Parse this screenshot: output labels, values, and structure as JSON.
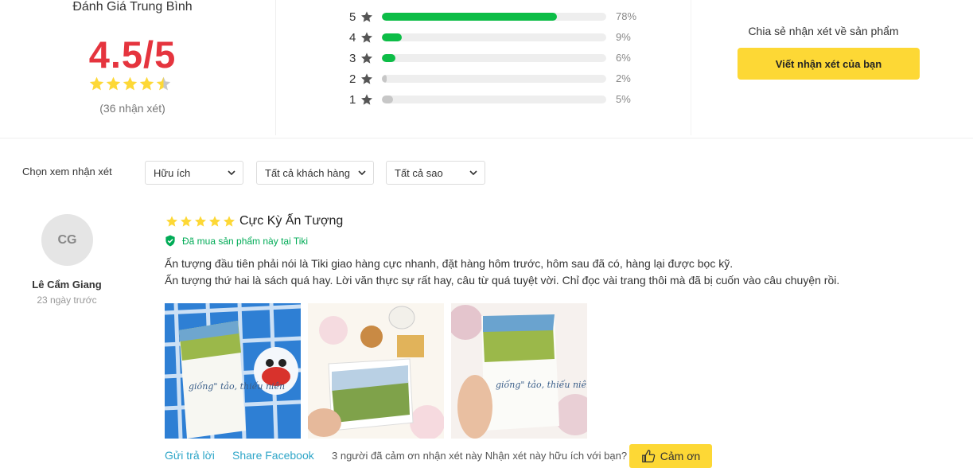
{
  "summary": {
    "title": "Đánh Giá Trung Bình",
    "score": "4.5/5",
    "star_rating": 4.5,
    "count": "(36 nhận xét)"
  },
  "distribution": [
    {
      "stars": "5",
      "percent": "78%",
      "fraction": 0.78
    },
    {
      "stars": "4",
      "percent": "9%",
      "fraction": 0.09
    },
    {
      "stars": "3",
      "percent": "6%",
      "fraction": 0.06
    },
    {
      "stars": "2",
      "percent": "2%",
      "fraction": 0.02
    },
    {
      "stars": "1",
      "percent": "5%",
      "fraction": 0.05
    }
  ],
  "share": {
    "text": "Chia sẻ nhận xét về sản phẩm",
    "button": "Viết nhận xét của bạn"
  },
  "filters": {
    "label": "Chọn xem nhận xét",
    "sort": "Hữu ích",
    "customers": "Tất cả khách hàng",
    "stars": "Tất cả sao"
  },
  "review": {
    "avatar_initials": "CG",
    "name": "Lê Cẩm Giang",
    "time": "23 ngày trước",
    "stars": 5,
    "title": "Cực Kỳ Ấn Tượng",
    "verified": "Đã mua sản phẩm này tại Tiki",
    "body_line1": "Ấn tượng đầu tiên phải nói là Tiki giao hàng cực nhanh, đặt hàng hôm trước, hôm sau đã có, hàng lại được bọc kỹ.",
    "body_line2": "Ấn tượng thứ hai là sách quá hay. Lời văn thực sự rất hay, câu từ quá tuyệt vời. Chỉ đọc vài trang thôi mà đã bị cuốn vào câu chuyện rồi.",
    "photos": [
      {
        "book_text": "giống\" tảo, thiếu niên"
      },
      {
        "book_text": ""
      },
      {
        "book_text": "giống\" tảo, thiếu niên"
      }
    ],
    "reply": "Gửi trả lời",
    "share_facebook": "Share Facebook",
    "thanks_count": "3 người đã cảm ơn nhận xét này",
    "helpful_question": "Nhận xét này hữu ích với bạn?",
    "thanks_button": "Cảm ơn"
  },
  "colors": {
    "star": "#fdd836",
    "bar_green": "#0dbd47",
    "bar_gray": "#c7c7c7",
    "score_red": "#e5343e",
    "button_yellow": "#fdd835"
  }
}
